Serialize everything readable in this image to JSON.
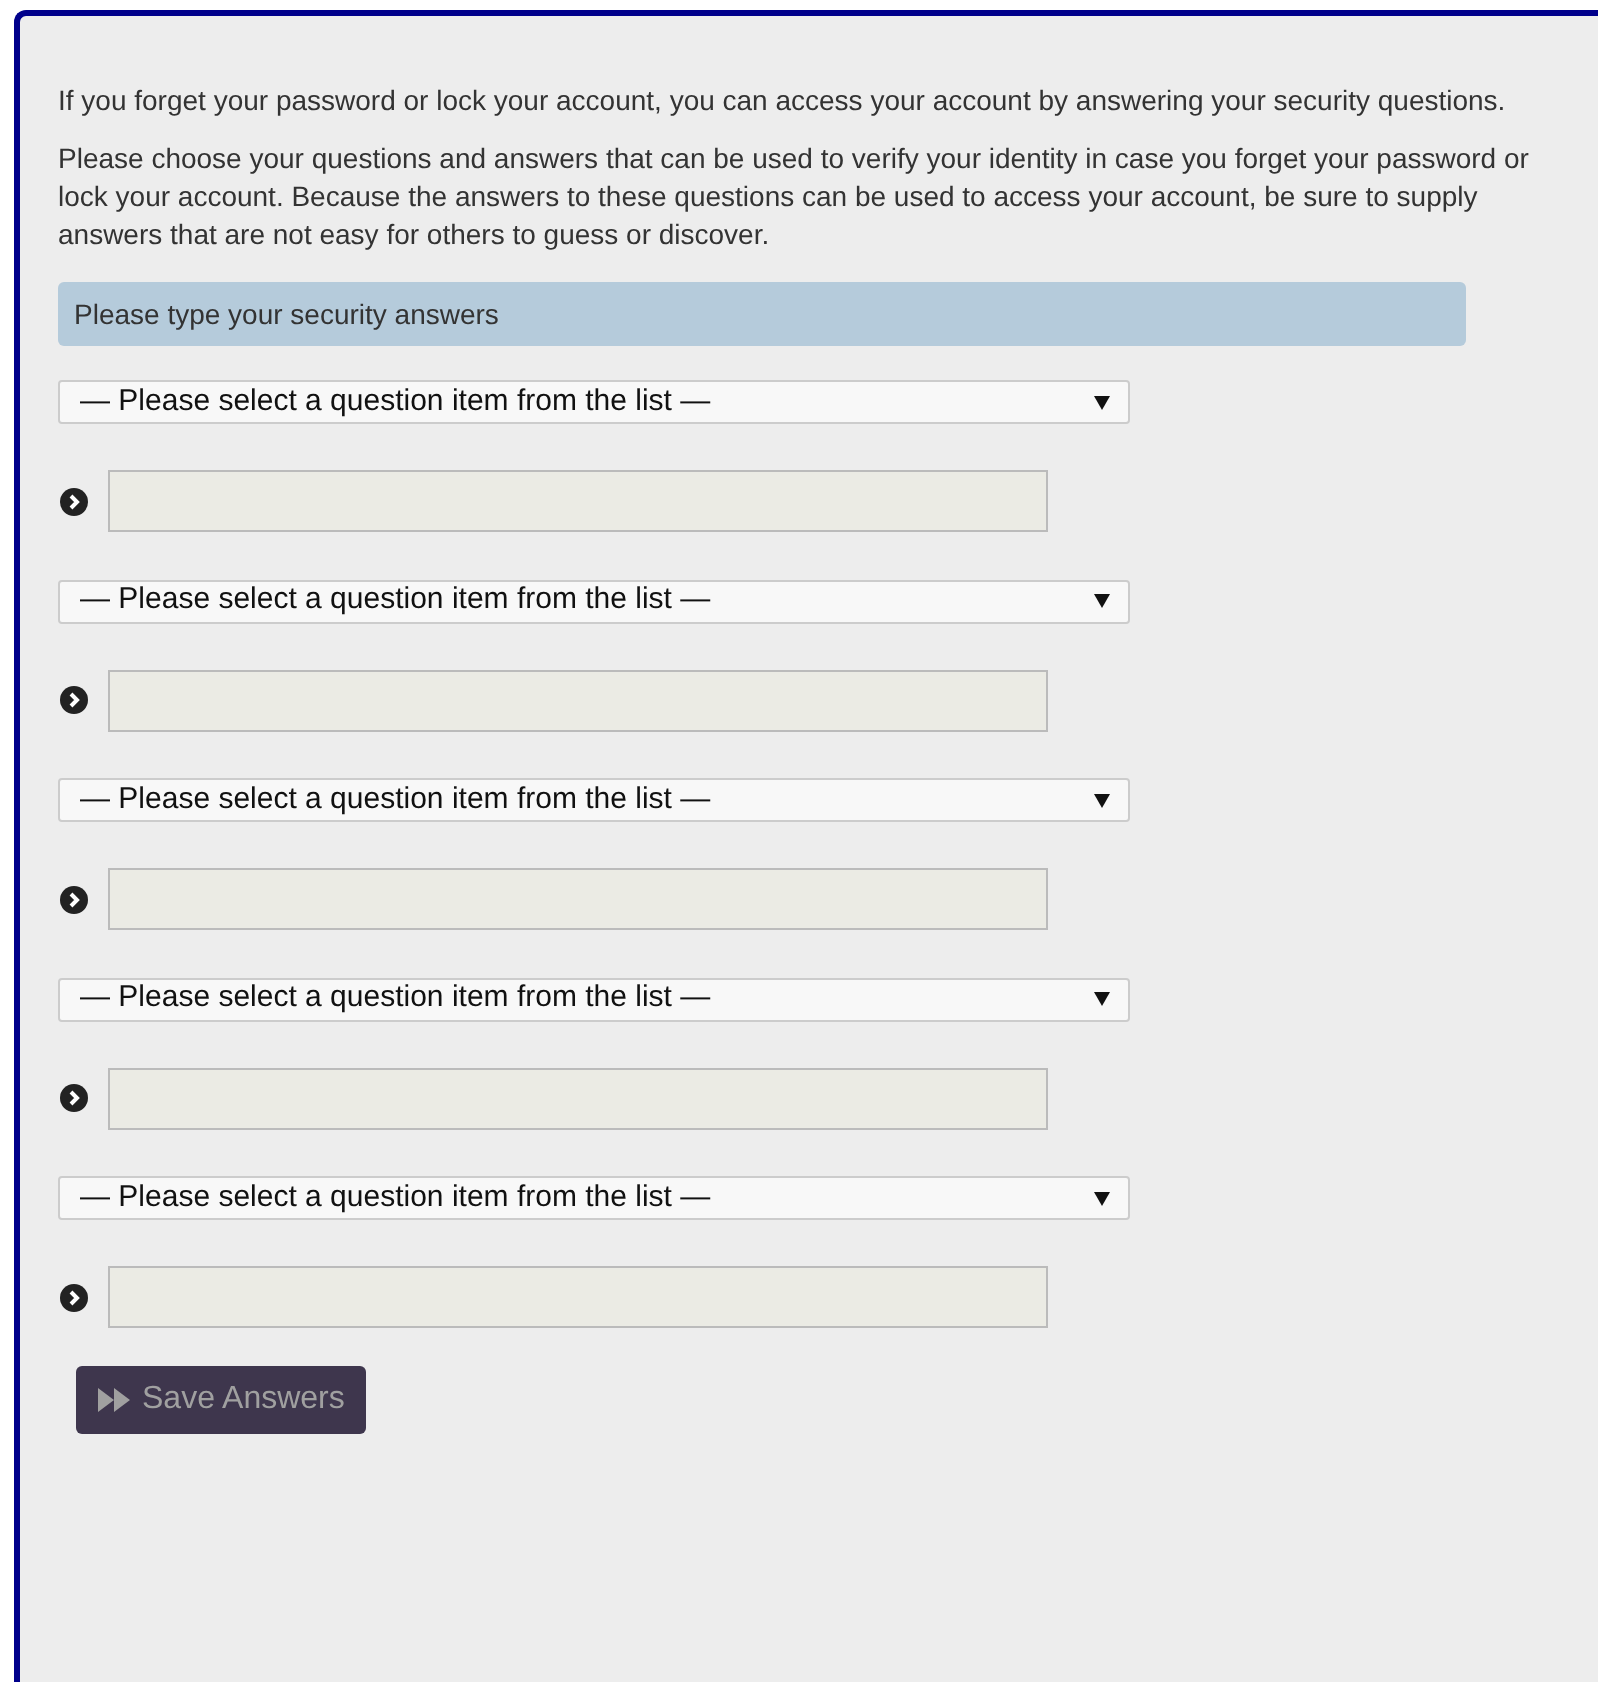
{
  "intro": [
    "If you forget your password or lock your account, you can access your account by answering your security questions.",
    "Please choose your questions and answers that can be used to verify your identity in case you forget your password or lock your account. Because the answers to these questions can be used to access your account, be sure to supply answers that are not easy for others to guess or discover."
  ],
  "section_header": "Please type your security answers",
  "questions": [
    {
      "select": "— Please select a question item from the list —"
    },
    {
      "select": "— Please select a question item from the list —"
    },
    {
      "select": "— Please select a question item from the list —"
    },
    {
      "select": "— Please select a question item from the list —"
    },
    {
      "select": "— Please select a question item from the list —"
    }
  ],
  "save_button": "Save Answers"
}
